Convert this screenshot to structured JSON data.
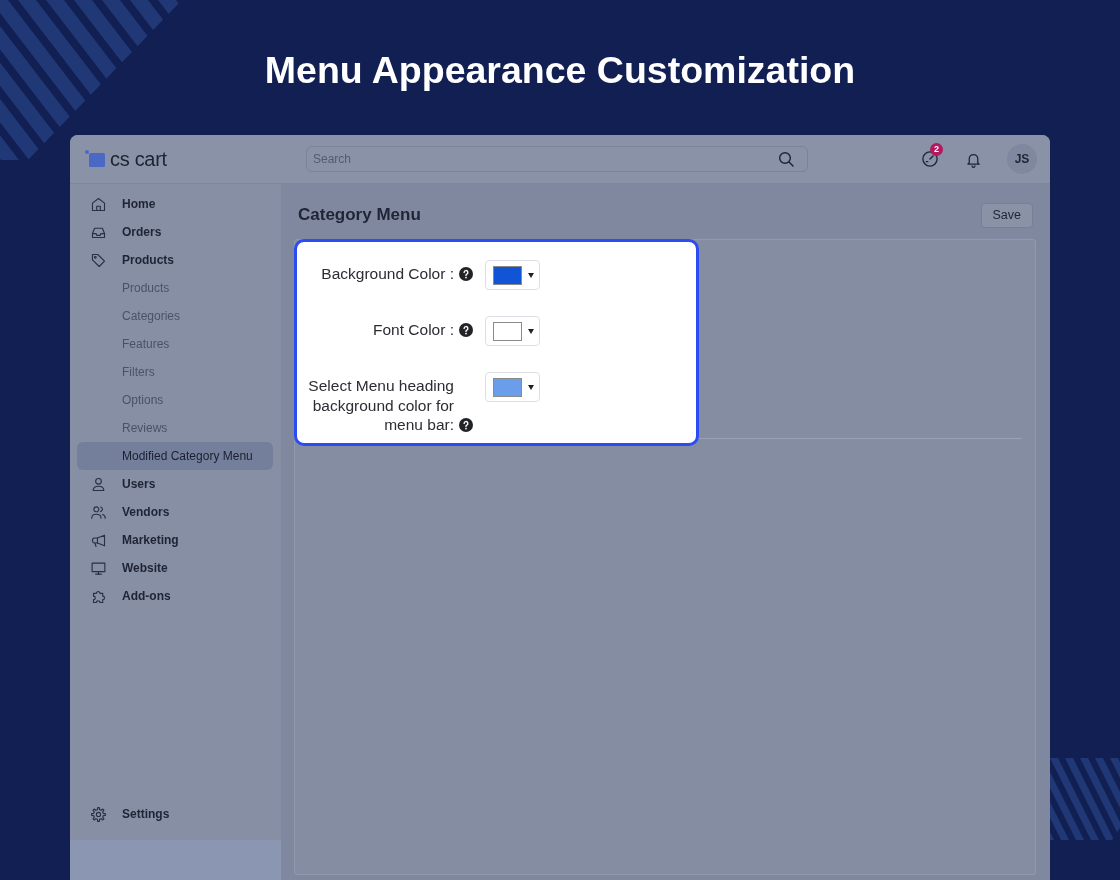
{
  "banner": {
    "title": "Menu Appearance Customization"
  },
  "header": {
    "logo": "cs cart",
    "search": {
      "placeholder": "Search"
    },
    "notification_count": "2",
    "avatar": "JS"
  },
  "sidebar": {
    "items": [
      {
        "label": "Home",
        "selected": false
      },
      {
        "label": "Orders",
        "selected": false
      },
      {
        "label": "Products",
        "selected": false,
        "children": [
          {
            "label": "Products",
            "selected": false
          },
          {
            "label": "Categories",
            "selected": false
          },
          {
            "label": "Features",
            "selected": false
          },
          {
            "label": "Filters",
            "selected": false
          },
          {
            "label": "Options",
            "selected": false
          },
          {
            "label": "Reviews",
            "selected": false
          },
          {
            "label": "Modified Category Menu",
            "selected": true
          }
        ]
      },
      {
        "label": "Users",
        "selected": false
      },
      {
        "label": "Vendors",
        "selected": false
      },
      {
        "label": "Marketing",
        "selected": false
      },
      {
        "label": "Website",
        "selected": false
      },
      {
        "label": "Add-ons",
        "selected": false
      }
    ],
    "footer_item": {
      "label": "Settings"
    }
  },
  "page": {
    "title": "Category Menu",
    "save_button": "Save",
    "settings_card": {
      "fields": [
        {
          "label": "Background Color :",
          "color": "#1254d6"
        },
        {
          "label": "Font Color :",
          "color": "#ffffff"
        },
        {
          "label": "Select Menu heading background color for menu bar:",
          "color": "#6b9eea"
        }
      ]
    }
  }
}
